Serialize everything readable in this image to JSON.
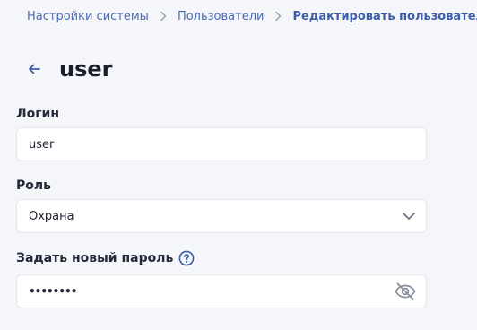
{
  "breadcrumb": {
    "items": [
      {
        "label": "Настройки системы"
      },
      {
        "label": "Пользователи"
      },
      {
        "label": "Редактировать пользователя"
      }
    ]
  },
  "header": {
    "title": "user",
    "back_icon": "arrow-left-icon"
  },
  "form": {
    "login": {
      "label": "Логин",
      "value": "user"
    },
    "role": {
      "label": "Роль",
      "selected": "Охрана",
      "icon": "chevron-down-icon"
    },
    "password": {
      "label": "Задать новый пароль",
      "value": "••••••••",
      "help_icon": "question-circle-icon",
      "visibility_icon": "eye-off-icon"
    }
  },
  "colors": {
    "accent": "#3c5ea8",
    "link": "#4d6bb3",
    "background": "#f4f6f9",
    "input_border": "#e3e6ec",
    "icon_gray": "#8a8f9c"
  }
}
